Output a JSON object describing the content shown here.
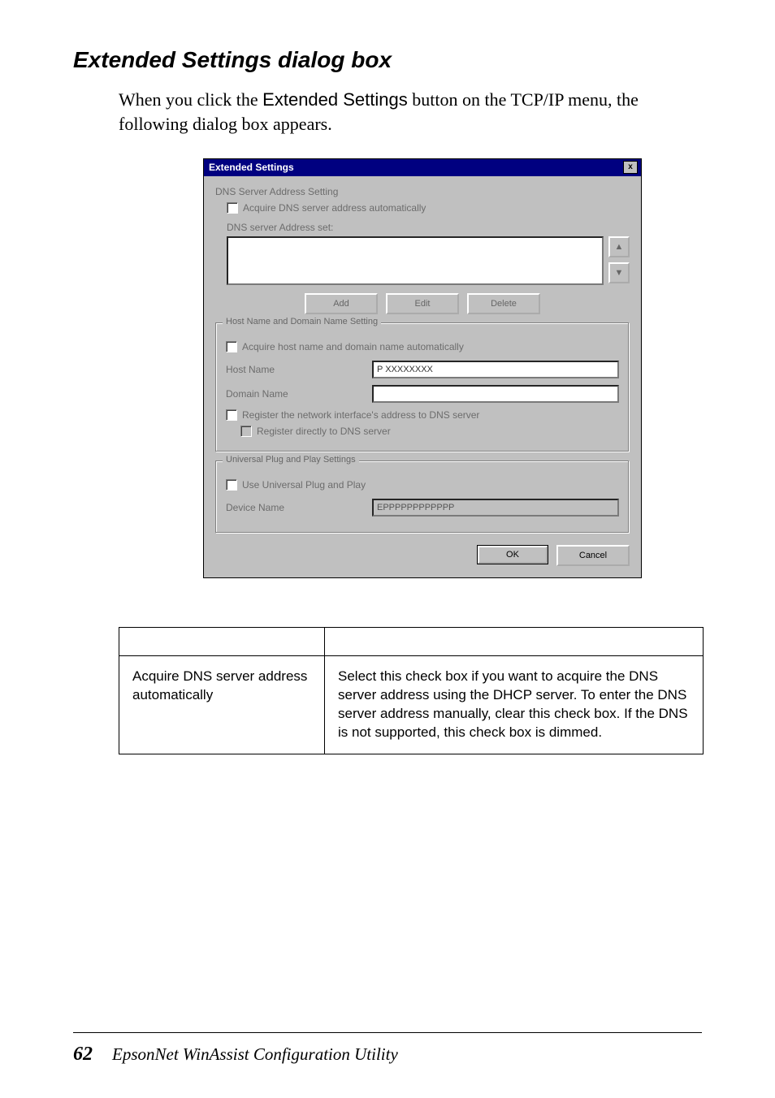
{
  "section_title": "Extended Settings dialog box",
  "intro": {
    "before": "When you click the ",
    "button_label": "Extended Settings",
    "after": " button on the TCP/IP menu, the following dialog box appears."
  },
  "dialog": {
    "title": "Extended Settings",
    "close_symbol": "x",
    "dns": {
      "heading": "DNS Server Address Setting",
      "acquire_chk": "Acquire DNS server address automatically",
      "list_label": "DNS server Address set:",
      "btn_up": "▲",
      "btn_down": "▼",
      "btn_add": "Add",
      "btn_edit": "Edit",
      "btn_delete": "Delete"
    },
    "hostname": {
      "legend": "Host Name and Domain Name Setting",
      "acquire_chk": "Acquire host name and domain name automatically",
      "host_label": "Host Name",
      "host_value": "P               XXXXXXXX",
      "domain_label": "Domain Name",
      "register_chk": "Register the network interface's address to DNS server",
      "register_direct_chk": "Register directly to DNS server"
    },
    "upnp": {
      "legend": "Universal Plug and Play Settings",
      "use_chk": "Use Universal Plug and Play",
      "device_label": "Device Name",
      "device_value": "EPPPPPPPPPPPP"
    },
    "footer": {
      "ok": "OK",
      "cancel": "Cancel"
    }
  },
  "table": {
    "headers": [
      "",
      ""
    ],
    "rows": [
      {
        "name": "Acquire DNS server address automatically",
        "desc": "Select this check box if you want to acquire the DNS server address using the DHCP server. To enter the DNS server address manually, clear this check box. If the DNS is not supported, this check box is dimmed."
      }
    ]
  },
  "footer": {
    "page": "62",
    "title": "EpsonNet WinAssist Configuration Utility"
  }
}
